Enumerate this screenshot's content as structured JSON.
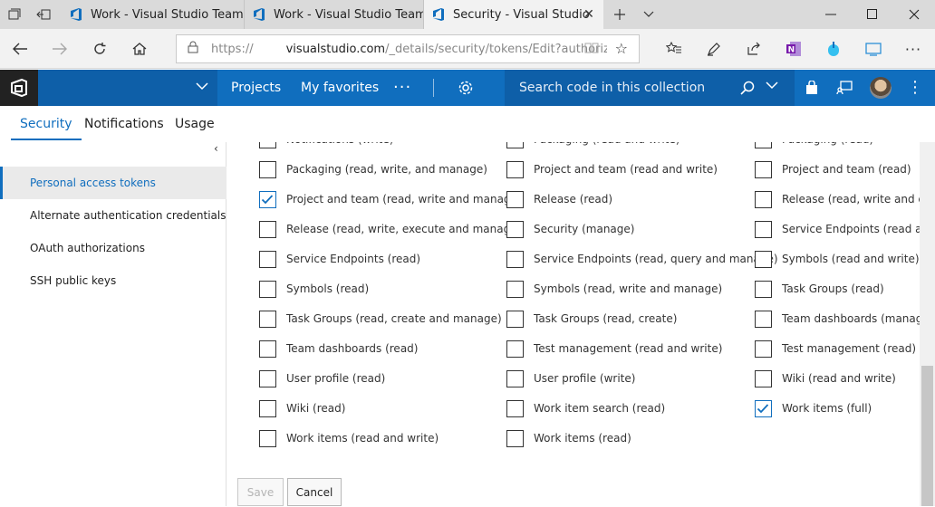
{
  "browser": {
    "tabs": [
      {
        "title": "Work - Visual Studio Team S"
      },
      {
        "title": "Work - Visual Studio Team S"
      },
      {
        "title": "Security - Visual Studio"
      }
    ],
    "address": {
      "protocol": "https://",
      "host": "visualstudio.com",
      "path": "/_details/security/tokens/Edit?authoriza"
    }
  },
  "header": {
    "nav": [
      "Projects",
      "My favorites"
    ],
    "search_placeholder": "Search code in this collection"
  },
  "hub_tabs": [
    {
      "label": "Security",
      "active": true
    },
    {
      "label": "Notifications",
      "active": false
    },
    {
      "label": "Usage",
      "active": false
    }
  ],
  "sidebar": {
    "items": [
      {
        "label": "Personal access tokens",
        "selected": true
      },
      {
        "label": "Alternate authentication credentials",
        "selected": false
      },
      {
        "label": "OAuth authorizations",
        "selected": false
      },
      {
        "label": "SSH public keys",
        "selected": false
      }
    ]
  },
  "scopes": {
    "col1": [
      {
        "label": "Notifications (write)",
        "checked": false
      },
      {
        "label": "Packaging (read, write, and manage)",
        "checked": false
      },
      {
        "label": "Project and team (read, write and manage)",
        "checked": true
      },
      {
        "label": "Release (read, write, execute and manage)",
        "checked": false
      },
      {
        "label": "Service Endpoints (read)",
        "checked": false
      },
      {
        "label": "Symbols (read)",
        "checked": false
      },
      {
        "label": "Task Groups (read, create and manage)",
        "checked": false
      },
      {
        "label": "Team dashboards (read)",
        "checked": false
      },
      {
        "label": "User profile (read)",
        "checked": false
      },
      {
        "label": "Wiki (read)",
        "checked": false
      },
      {
        "label": "Work items (read and write)",
        "checked": false
      }
    ],
    "col2": [
      {
        "label": "Packaging (read and write)",
        "checked": false
      },
      {
        "label": "Project and team (read and write)",
        "checked": false
      },
      {
        "label": "Release (read)",
        "checked": false
      },
      {
        "label": "Security (manage)",
        "checked": false
      },
      {
        "label": "Service Endpoints (read, query and manage)",
        "checked": false
      },
      {
        "label": "Symbols (read, write and manage)",
        "checked": false
      },
      {
        "label": "Task Groups (read, create)",
        "checked": false
      },
      {
        "label": "Test management (read and write)",
        "checked": false
      },
      {
        "label": "User profile (write)",
        "checked": false
      },
      {
        "label": "Work item search (read)",
        "checked": false
      },
      {
        "label": "Work items (read)",
        "checked": false
      }
    ],
    "col3": [
      {
        "label": "Packaging (read)",
        "checked": false
      },
      {
        "label": "Project and team (read)",
        "checked": false
      },
      {
        "label": "Release (read, write and exec",
        "checked": false
      },
      {
        "label": "Service Endpoints (read and c",
        "checked": false
      },
      {
        "label": "Symbols (read and write)",
        "checked": false
      },
      {
        "label": "Task Groups (read)",
        "checked": false
      },
      {
        "label": "Team dashboards (manage)",
        "checked": false
      },
      {
        "label": "Test management (read)",
        "checked": false
      },
      {
        "label": "Wiki (read and write)",
        "checked": false
      },
      {
        "label": "Work items (full)",
        "checked": true
      }
    ]
  },
  "actions": {
    "save_label": "Save",
    "cancel_label": "Cancel"
  },
  "colors": {
    "accent": "#106ebe",
    "header_bg": "#106ebe",
    "logo_bg": "#222222"
  }
}
